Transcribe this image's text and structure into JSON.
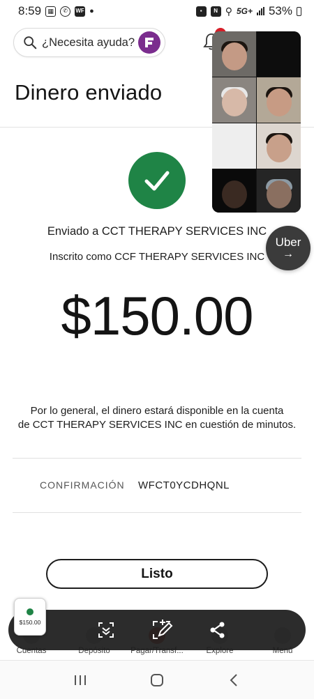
{
  "status_bar": {
    "time": "8:59",
    "network": "5G+",
    "battery": "53%"
  },
  "header": {
    "help_placeholder": "¿Necesita ayuda?",
    "title": "Dinero enviado"
  },
  "result": {
    "sent_to": "Enviado a CCT THERAPY SERVICES INC",
    "enrolled_as": "Inscrito como CCF THERAPY SERVICES INC",
    "amount": "$150.00",
    "availability_line1": "Por lo general, el dinero estará disponible en la cuenta",
    "availability_line2": "de CCT THERAPY SERVICES INC en cuestión de minutos.",
    "confirmation_label": "CONFIRMACIÓN",
    "confirmation_value": "WFCT0YCDHQNL",
    "done_label": "Listo",
    "success_color": "#1f8446"
  },
  "uber_bubble": {
    "label": "Uber",
    "arrow": "→"
  },
  "bottom_nav": {
    "items": [
      {
        "label": "Cuentas",
        "icon": "accounts-icon"
      },
      {
        "label": "Depósito",
        "icon": "deposit-icon"
      },
      {
        "label": "Pagar/Transf...",
        "icon": "pay-transfer-icon"
      },
      {
        "label": "Explore",
        "icon": "explore-icon"
      },
      {
        "label": "Menú",
        "icon": "menu-icon"
      }
    ]
  },
  "screenshot_toolbar": {
    "thumbnail_amount": "$150.00",
    "tools": [
      "scroll-capture-icon",
      "edit-icon",
      "share-icon"
    ]
  },
  "colors": {
    "brand_red": "#d71e28",
    "fargo_purple": "#7b2d8e",
    "toolbar_bg": "#1c1c1c"
  }
}
